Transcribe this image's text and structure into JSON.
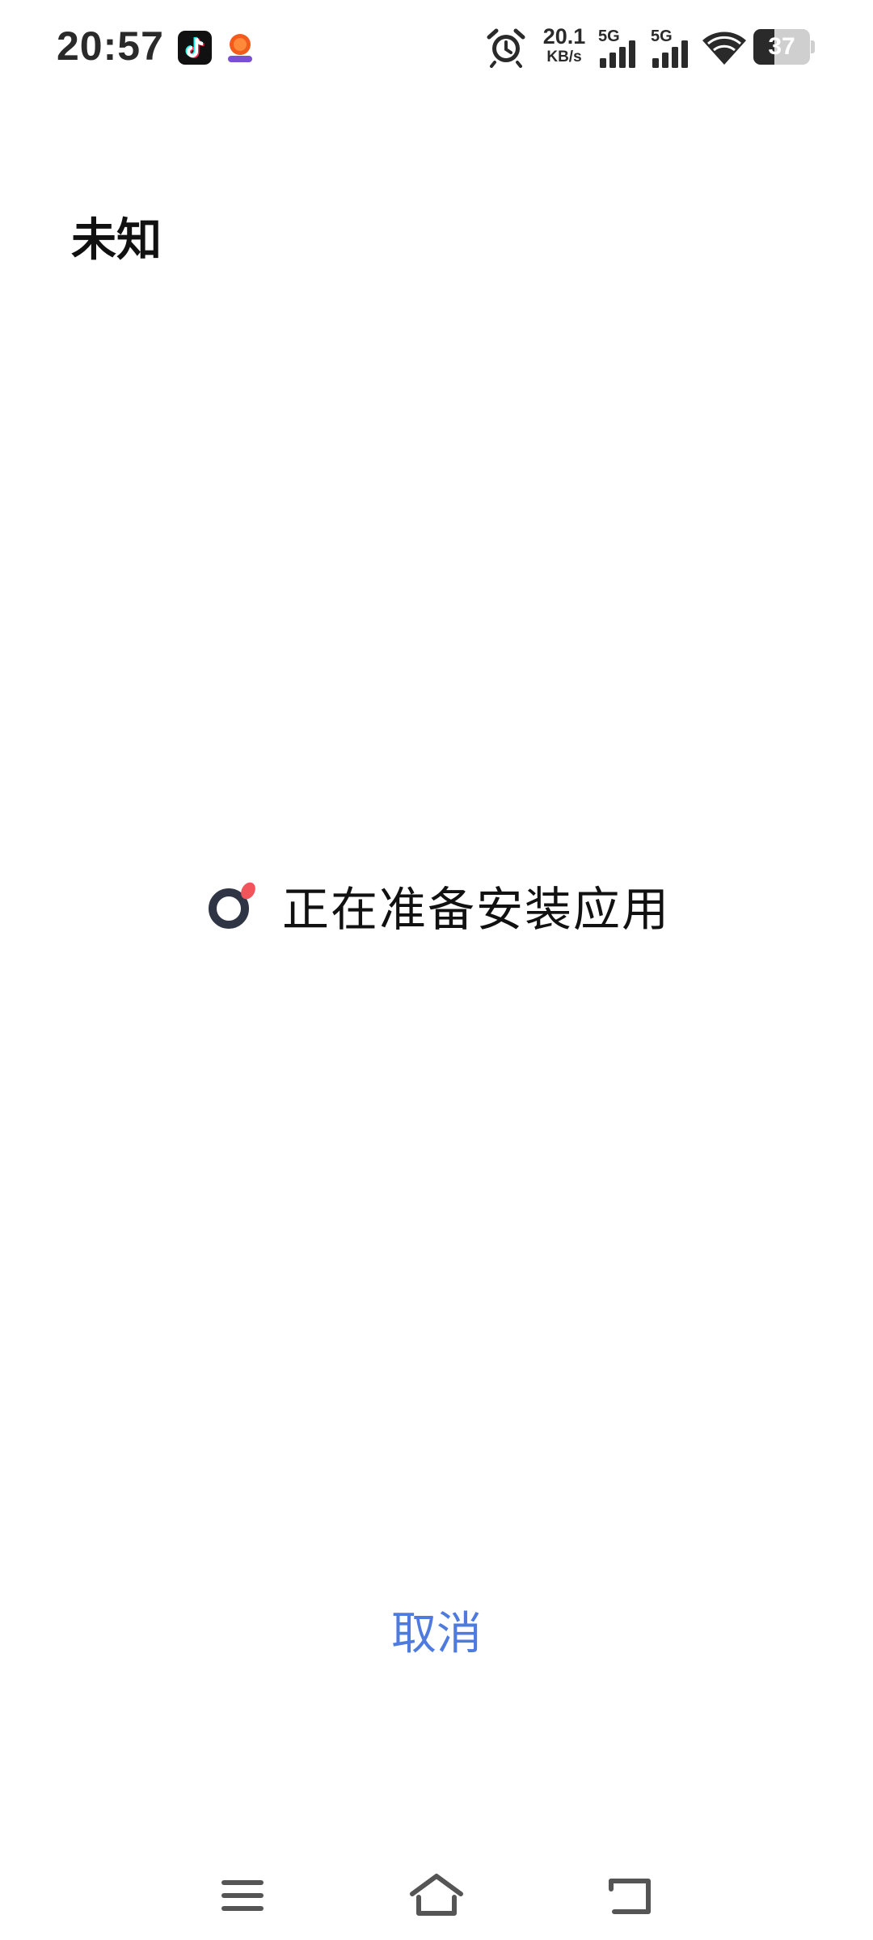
{
  "status_bar": {
    "time": "20:57",
    "network_speed_value": "20.1",
    "network_speed_unit": "KB/s",
    "sim1_label": "5G",
    "sim2_label": "5G",
    "battery_level": "37",
    "battery_fraction": 0.37
  },
  "notifications": [
    {
      "icon": "tiktok-icon"
    },
    {
      "icon": "shopping-app-icon"
    }
  ],
  "dialog": {
    "app_name": "未知",
    "progress_text": "正在准备安装应用",
    "cancel_label": "取消"
  },
  "colors": {
    "accent": "#4f7bdf",
    "spinner_ring": "#2f3544",
    "spinner_dot": "#f2545b"
  },
  "navigation": {
    "buttons": [
      "menu-icon",
      "home-icon",
      "back-icon"
    ]
  }
}
